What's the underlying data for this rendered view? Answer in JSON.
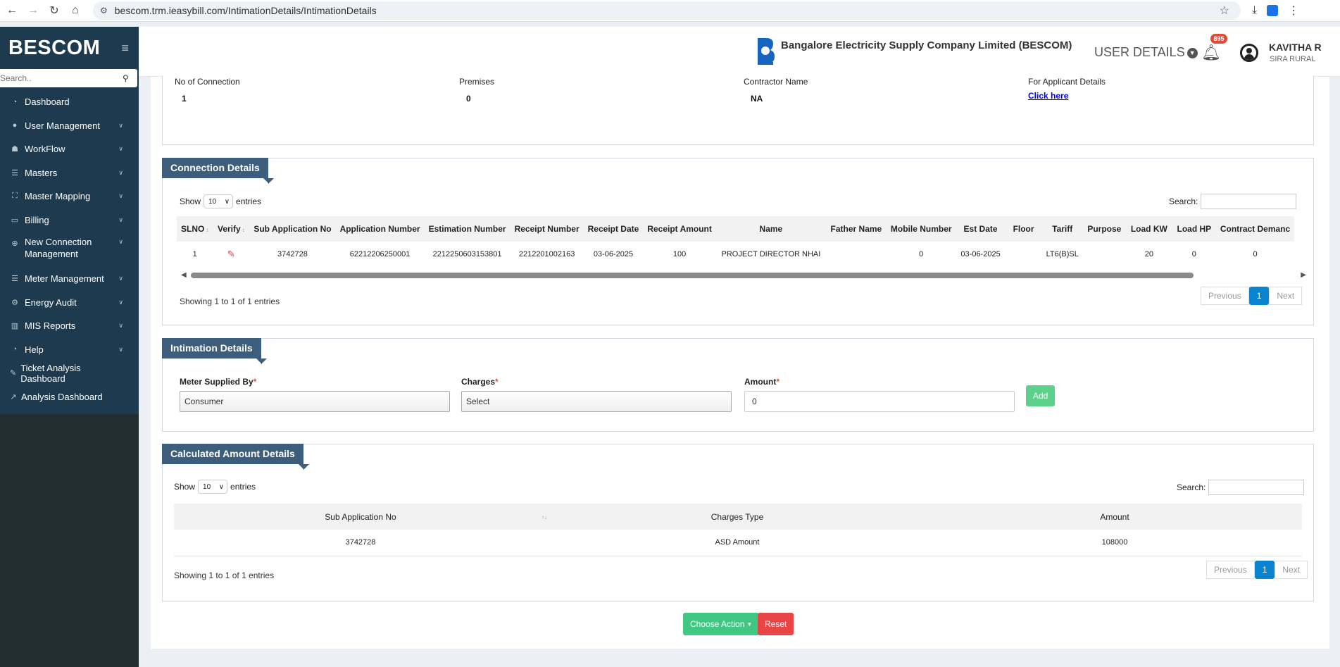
{
  "browser": {
    "url": "bescom.trm.ieasybill.com/IntimationDetails/IntimationDetails"
  },
  "sidebar": {
    "brand": "BESCOM",
    "search_placeholder": "Search..",
    "items": [
      {
        "label": "Dashboard",
        "icon": "dashboard-icon"
      },
      {
        "label": "User Management",
        "icon": "user-icon"
      },
      {
        "label": "WorkFlow",
        "icon": "workflow-icon"
      },
      {
        "label": "Masters",
        "icon": "list-icon"
      },
      {
        "label": "Master Mapping",
        "icon": "sitemap-icon"
      },
      {
        "label": "Billing",
        "icon": "desktop-icon"
      },
      {
        "label": "New Connection Management",
        "icon": "plus-circle-icon"
      },
      {
        "label": "Meter Management",
        "icon": "list-icon"
      },
      {
        "label": "Energy Audit",
        "icon": "cogs-icon"
      },
      {
        "label": "MIS Reports",
        "icon": "bar-chart-icon"
      },
      {
        "label": "Help",
        "icon": "dashboard-icon"
      },
      {
        "label": "Ticket Analysis Dashboard",
        "icon": "pencil-icon"
      },
      {
        "label": "Analysis Dashboard",
        "icon": "line-chart-icon"
      }
    ]
  },
  "header": {
    "org_name": "Bangalore Electricity Supply Company Limited (BESCOM)",
    "user_details": "USER DETAILS",
    "notif_count": "895",
    "user_name": "KAVITHA R",
    "user_sub": "SIRA RURAL"
  },
  "summary": {
    "no_of_connection_label": "No of Connection",
    "no_of_connection": "1",
    "premises_label": "Premises",
    "premises": "0",
    "contractor_label": "Contractor Name",
    "contractor": "NA",
    "applicant_label": "For Applicant Details",
    "applicant_link": "Click here"
  },
  "connection": {
    "title": "Connection Details",
    "show": "Show",
    "entries": "entries",
    "page_len": "10",
    "search": "Search:",
    "columns": [
      "SLNO",
      "Verify",
      "Sub Application No",
      "Application Number",
      "Estimation Number",
      "Receipt Number",
      "Receipt Date",
      "Receipt Amount",
      "Name",
      "Father Name",
      "Mobile Number",
      "Est Date",
      "Floor",
      "Tariff",
      "Purpose",
      "Load KW",
      "Load HP",
      "Contract Demanc"
    ],
    "row": [
      "1",
      "",
      "3742728",
      "62212206250001",
      "2212250603153801",
      "2212201002163",
      "03-06-2025",
      "100",
      "PROJECT DIRECTOR NHAI",
      "",
      "0",
      "03-06-2025",
      "",
      "LT6(B)SL",
      "",
      "20",
      "0",
      "0"
    ],
    "info": "Showing 1 to 1 of 1 entries",
    "prev": "Previous",
    "page": "1",
    "next": "Next"
  },
  "intimation": {
    "title": "Intimation Details",
    "meter_label": "Meter Supplied By",
    "meter_value": "Consumer",
    "charges_label": "Charges",
    "charges_value": "Select",
    "amount_label": "Amount",
    "amount_value": "0",
    "add": "Add",
    "req": "*"
  },
  "calculated": {
    "title": "Calculated Amount Details",
    "show": "Show",
    "entries": "entries",
    "page_len": "10",
    "search": "Search:",
    "columns": [
      "Sub Application No",
      "Charges Type",
      "Amount"
    ],
    "row": [
      "3742728",
      "ASD Amount",
      "108000"
    ],
    "info": "Showing 1 to 1 of 1 entries",
    "prev": "Previous",
    "page": "1",
    "next": "Next"
  },
  "actions": {
    "choose": "Choose Action",
    "reset": "Reset"
  }
}
